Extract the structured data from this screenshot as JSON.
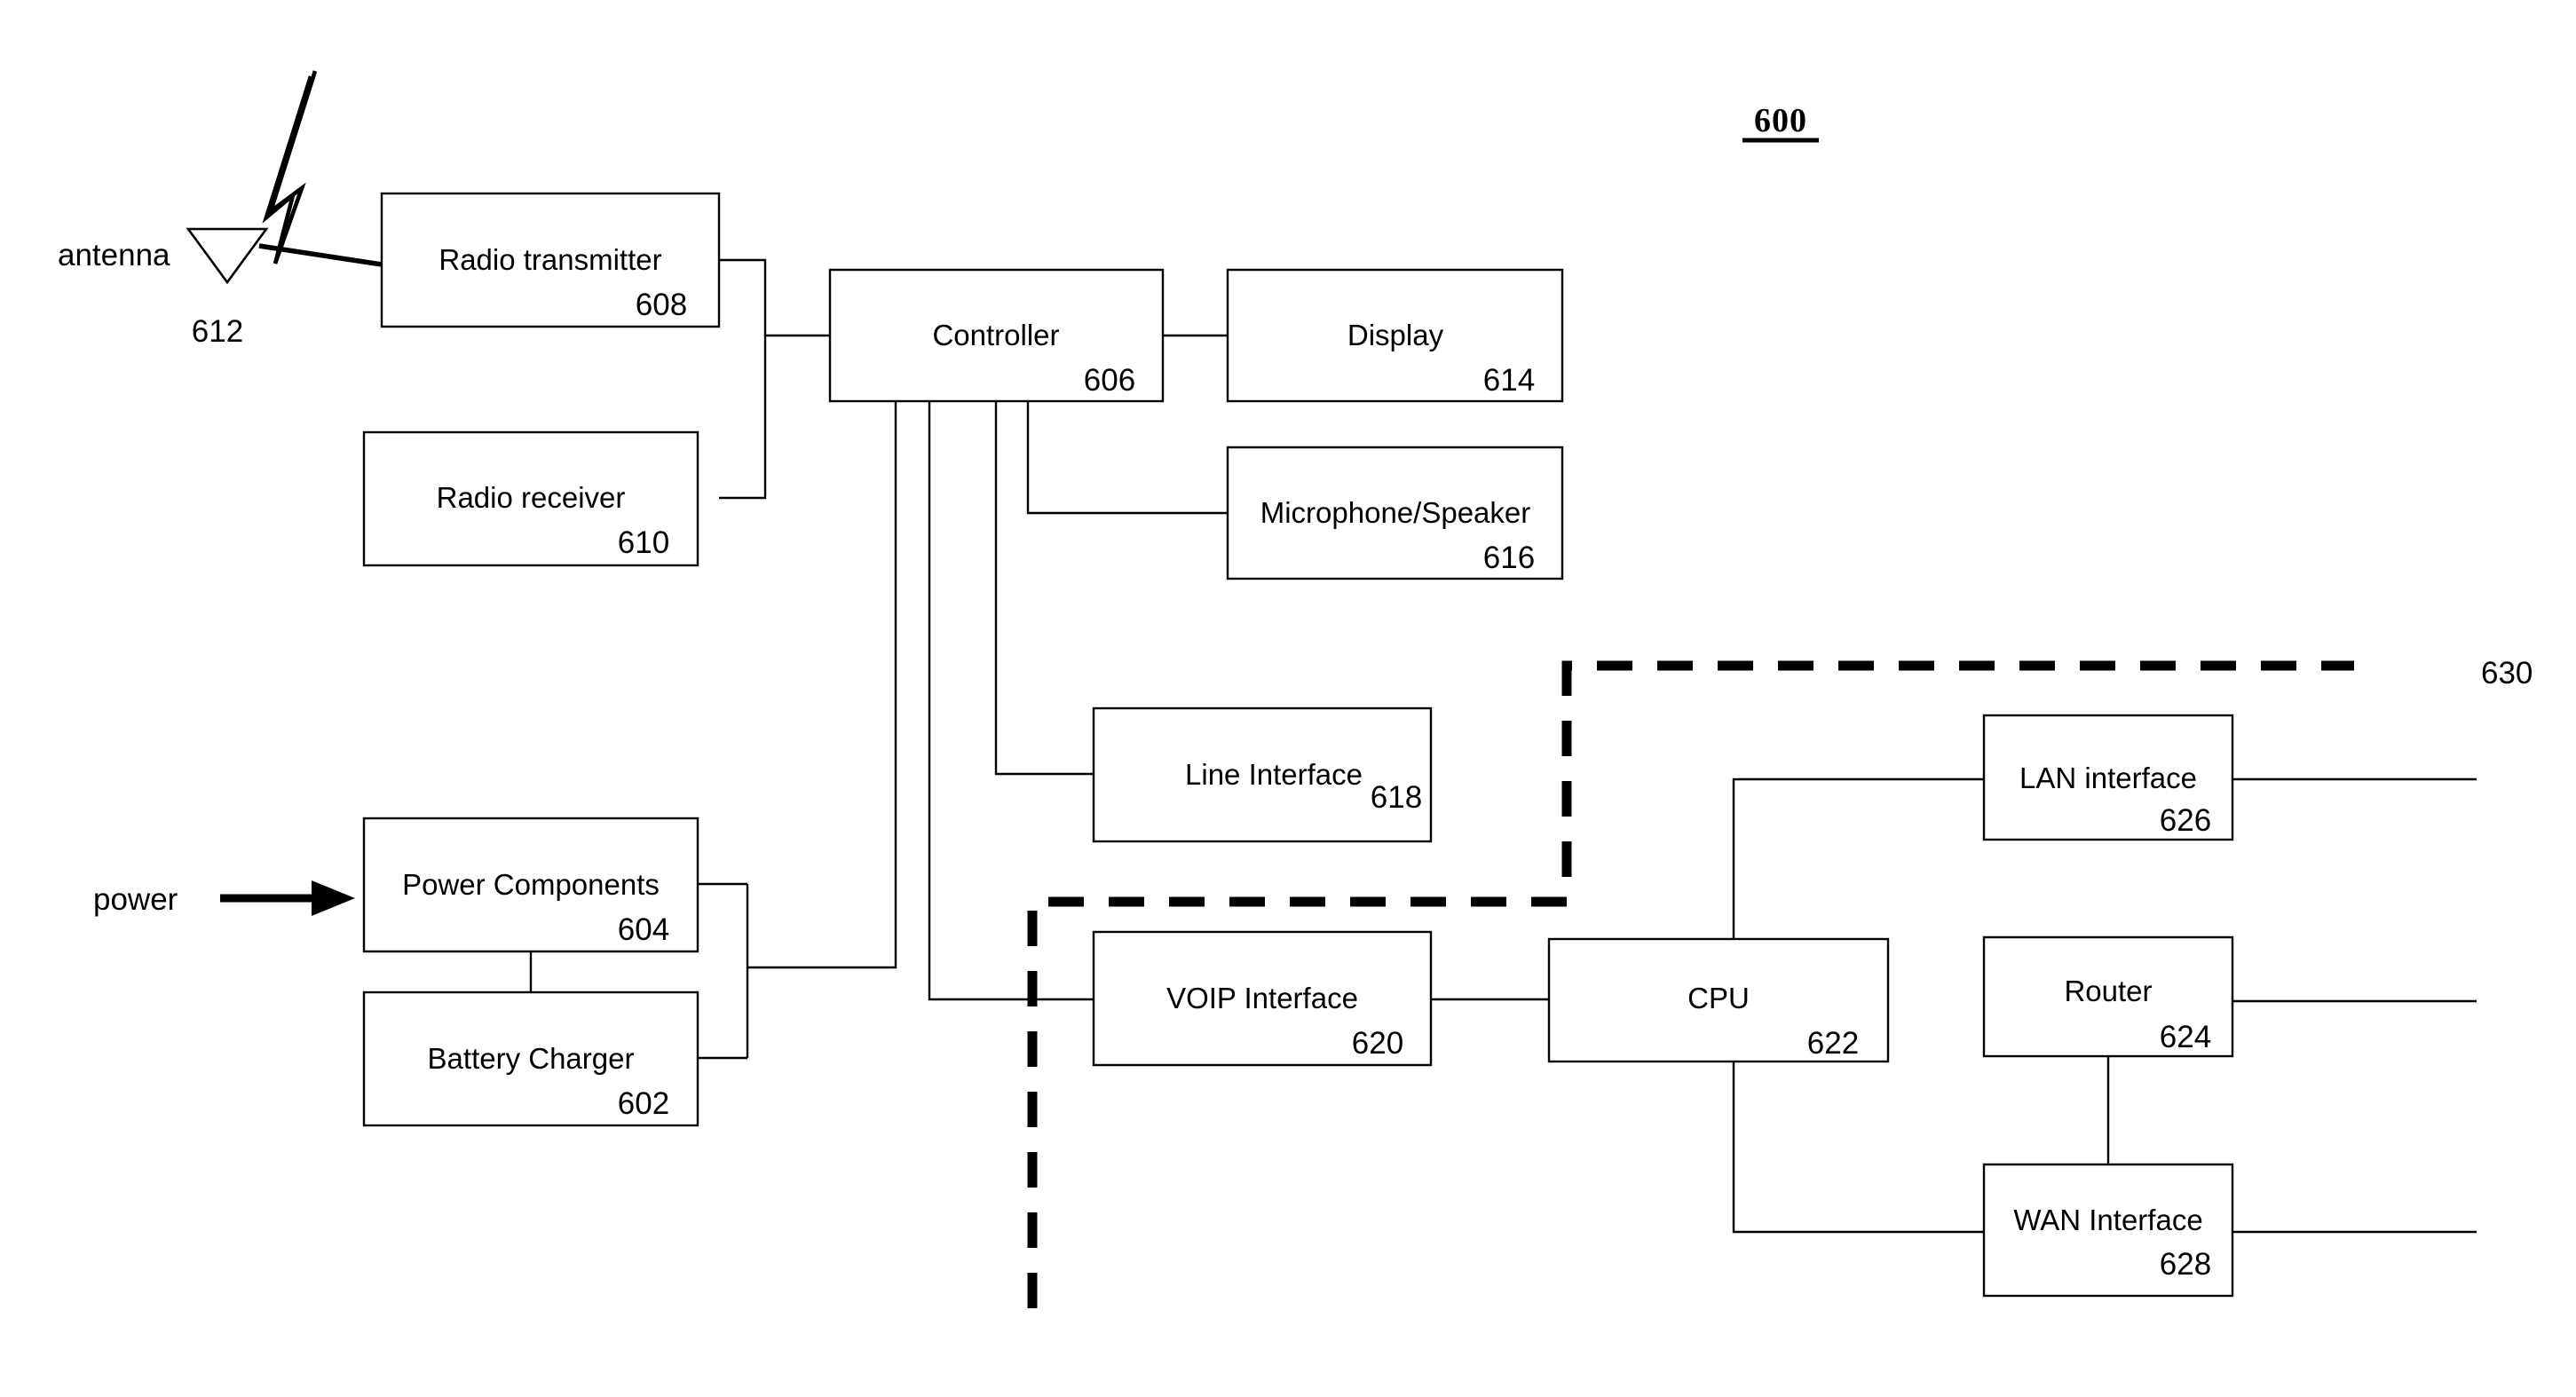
{
  "figure": {
    "number": "600",
    "boundary_label": "630"
  },
  "edge_labels": {
    "antenna": "antenna",
    "antenna_ref": "612",
    "power": "power"
  },
  "blocks": [
    {
      "id": "radio_transmitter",
      "title": "Radio transmitter",
      "num": "608"
    },
    {
      "id": "radio_receiver",
      "title": "Radio receiver",
      "num": "610"
    },
    {
      "id": "controller",
      "title": "Controller",
      "num": "606"
    },
    {
      "id": "display",
      "title": "Display",
      "num": "614"
    },
    {
      "id": "mic_speaker",
      "title": "Microphone/Speaker",
      "num": "616"
    },
    {
      "id": "line_interface",
      "title": "Line Interface",
      "num": "618"
    },
    {
      "id": "power_components",
      "title": "Power Components",
      "num": "604"
    },
    {
      "id": "battery_charger",
      "title": "Battery Charger",
      "num": "602"
    },
    {
      "id": "voip_interface",
      "title": "VOIP Interface",
      "num": "620"
    },
    {
      "id": "cpu",
      "title": "CPU",
      "num": "622"
    },
    {
      "id": "lan_interface",
      "title": "LAN interface",
      "num": "626"
    },
    {
      "id": "router",
      "title": "Router",
      "num": "624"
    },
    {
      "id": "wan_interface",
      "title": "WAN Interface",
      "num": "628"
    }
  ],
  "colors": {
    "stroke": "#000000",
    "fill": "#ffffff",
    "background": "#ffffff"
  }
}
